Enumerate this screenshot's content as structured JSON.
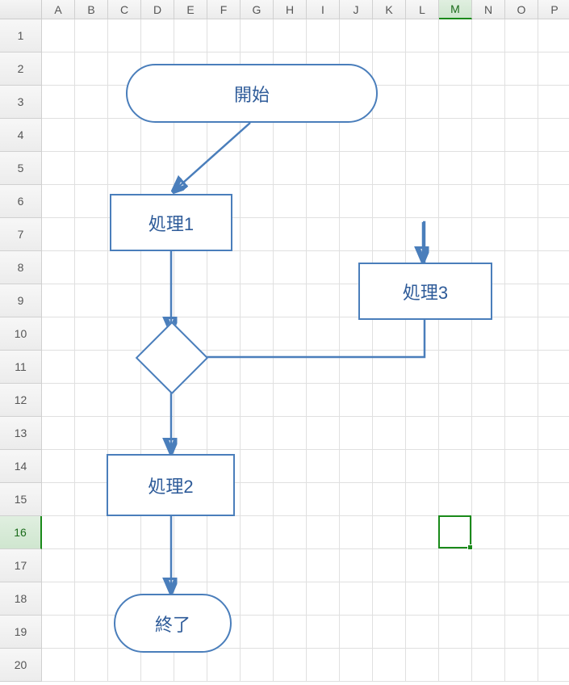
{
  "columns": [
    "A",
    "B",
    "C",
    "D",
    "E",
    "F",
    "G",
    "H",
    "I",
    "J",
    "K",
    "L",
    "M",
    "N",
    "O",
    "P"
  ],
  "rows": [
    "1",
    "2",
    "3",
    "4",
    "5",
    "6",
    "7",
    "8",
    "9",
    "10",
    "11",
    "12",
    "13",
    "14",
    "15",
    "16",
    "17",
    "18",
    "19",
    "20"
  ],
  "selected_column_index": 12,
  "selected_row_index": 15,
  "flowchart": {
    "start": "開始",
    "process1": "処理1",
    "process2": "処理2",
    "process3": "処理3",
    "end": "終了"
  },
  "colors": {
    "shape_border": "#4a7ebb",
    "text": "#2e5b99",
    "selection": "#1a8a1a"
  }
}
